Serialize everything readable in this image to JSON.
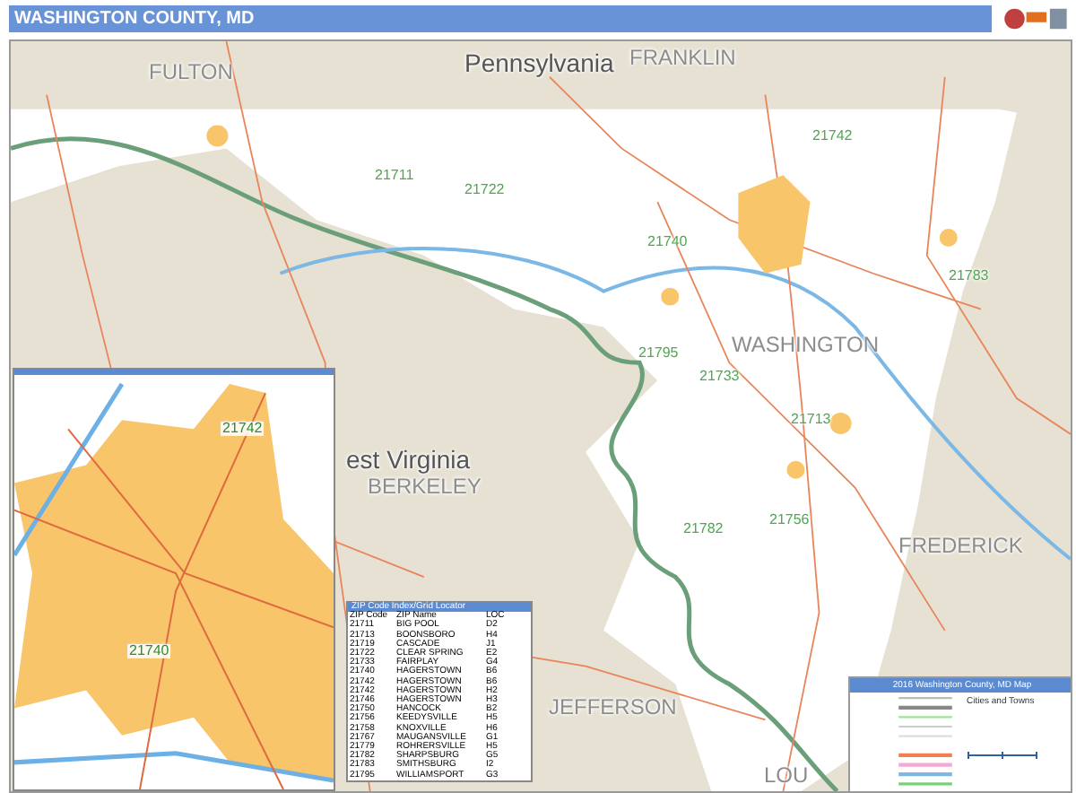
{
  "title": "WASHINGTON COUNTY, MD",
  "map_labels": [
    {
      "text": "FULTON",
      "kind": "county"
    },
    {
      "text": "Pennsylvania",
      "kind": "state"
    },
    {
      "text": "FRANKLIN",
      "kind": "county"
    },
    {
      "text": "21711",
      "kind": "zip"
    },
    {
      "text": "21722",
      "kind": "zip"
    },
    {
      "text": "21740",
      "kind": "zip"
    },
    {
      "text": "21742",
      "kind": "zip"
    },
    {
      "text": "21783",
      "kind": "zip"
    },
    {
      "text": "WASHINGTON",
      "kind": "county"
    },
    {
      "text": "21795",
      "kind": "zip"
    },
    {
      "text": "21733",
      "kind": "zip"
    },
    {
      "text": "21713",
      "kind": "zip"
    },
    {
      "text": "21756",
      "kind": "zip"
    },
    {
      "text": "21782",
      "kind": "zip"
    },
    {
      "text": "est Virginia",
      "kind": "state"
    },
    {
      "text": "BERKELEY",
      "kind": "county"
    },
    {
      "text": "FREDERICK",
      "kind": "county"
    },
    {
      "text": "JEFFERSON",
      "kind": "county"
    },
    {
      "text": "LOU",
      "kind": "county"
    }
  ],
  "inset": {
    "labels": [
      "21742",
      "21740"
    ]
  },
  "zip_table": {
    "title": "ZIP Code Index/Grid Locator",
    "columns": [
      "ZIP Code",
      "ZIP Name",
      "LOC"
    ],
    "rows": [
      [
        "21711",
        "BIG POOL",
        "D2"
      ],
      [
        "21713",
        "BOONSBORO",
        "H4"
      ],
      [
        "21719",
        "CASCADE",
        "J1"
      ],
      [
        "21722",
        "CLEAR SPRING",
        "E2"
      ],
      [
        "21733",
        "FAIRPLAY",
        "G4"
      ],
      [
        "21740",
        "HAGERSTOWN",
        "B6"
      ],
      [
        "21742",
        "HAGERSTOWN",
        "B6"
      ],
      [
        "21742",
        "HAGERSTOWN",
        "H2"
      ],
      [
        "21746",
        "HAGERSTOWN",
        "H3"
      ],
      [
        "21750",
        "HANCOCK",
        "B2"
      ],
      [
        "21756",
        "KEEDYSVILLE",
        "H5"
      ],
      [
        "21758",
        "KNOXVILLE",
        "H6"
      ],
      [
        "21767",
        "MAUGANSVILLE",
        "G1"
      ],
      [
        "21779",
        "ROHRERSVILLE",
        "H5"
      ],
      [
        "21782",
        "SHARPSBURG",
        "G5"
      ],
      [
        "21783",
        "SMITHSBURG",
        "I2"
      ],
      [
        "21795",
        "WILLIAMSPORT",
        "G3"
      ]
    ]
  },
  "legend": {
    "title": "2016 Washington County, MD Map",
    "section": "Cities and Towns"
  }
}
